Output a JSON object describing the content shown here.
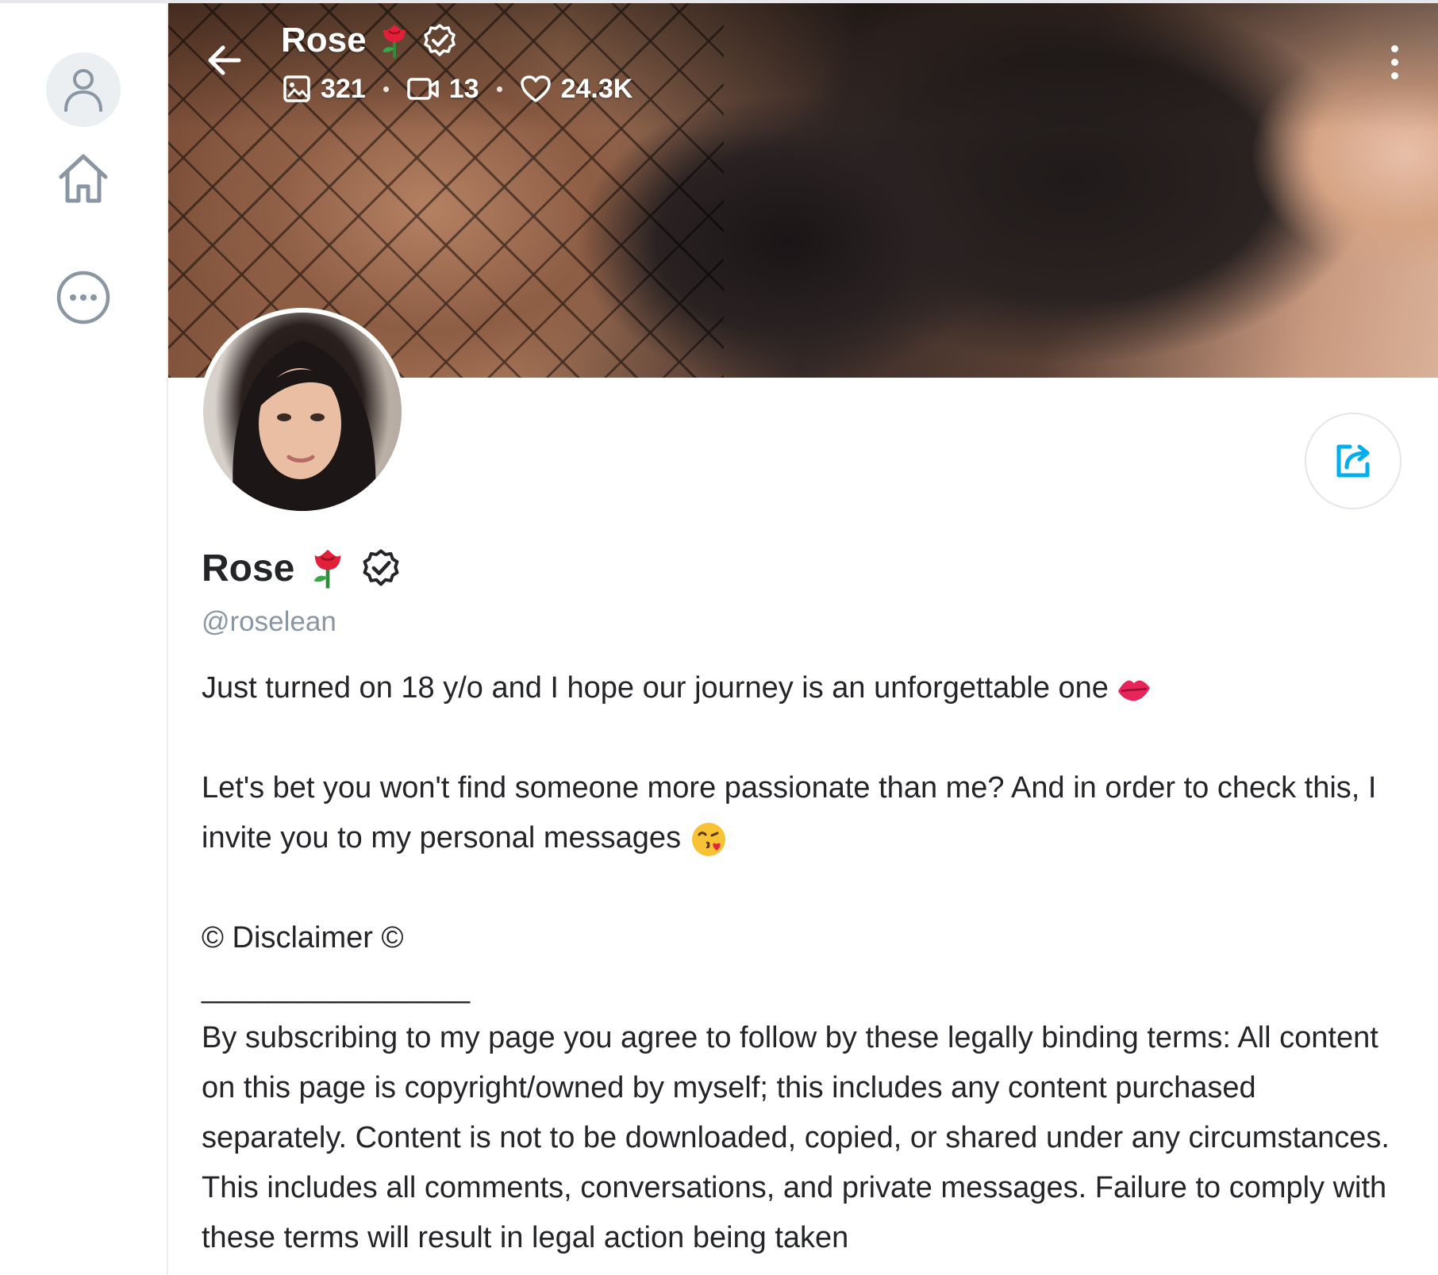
{
  "header": {
    "name": "Rose",
    "stats": {
      "photos": "321",
      "videos": "13",
      "likes": "24.3K"
    }
  },
  "profile": {
    "name": "Rose",
    "handle": "@roselean"
  },
  "bio": {
    "line1": "Just turned on 18 y/o and I hope our journey is an unforgettable one",
    "line2": "Let's bet you won't find someone more passionate than me? And in order to check this, I invite you to my personal messages",
    "disclaimer": "© Disclaimer ©",
    "divider": "________________",
    "terms": "By subscribing to my page you agree to follow by these legally binding terms: All content on this page is copyright/owned by myself; this includes any content pur­chased separately. Content is not to be downloaded, copied, or shared under any circumstances. This includes all comments, conversations, and private mes­sages. Failure to comply with these terms will result in legal action being taken"
  },
  "icons": {
    "back": "arrow-left-icon",
    "photos": "image-icon",
    "videos": "video-icon",
    "likes": "heart-icon",
    "verified": "verified-badge-icon",
    "rose": "rose-emoji-icon",
    "lips": "lips-emoji-icon",
    "kiss": "kissing-face-emoji-icon",
    "share": "share-icon",
    "more": "more-vertical-icon",
    "rail_user": "user-icon",
    "rail_home": "home-icon",
    "rail_more": "more-horizontal-icon"
  },
  "colors": {
    "accent": "#00aff0",
    "muted": "#8a96a3",
    "text": "#242529"
  }
}
